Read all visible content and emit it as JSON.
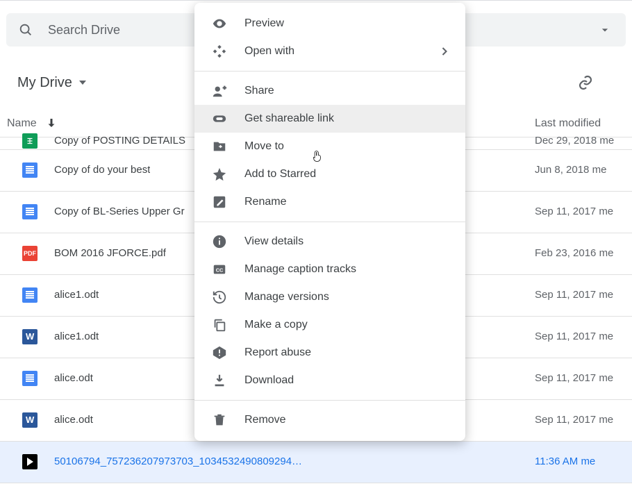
{
  "search": {
    "placeholder": "Search Drive"
  },
  "breadcrumb": {
    "label": "My Drive"
  },
  "columns": {
    "name": "Name",
    "modified": "Last modified"
  },
  "rows": [
    {
      "type": "sheets",
      "name": "Copy of POSTING DETAILS",
      "date": "Dec 29, 2018",
      "who": "me",
      "cut": true
    },
    {
      "type": "docs",
      "name": "Copy of do your best",
      "date": "Jun 8, 2018",
      "who": "me"
    },
    {
      "type": "docs",
      "name": "Copy of BL-Series Upper Gr",
      "date": "Sep 11, 2017",
      "who": "me"
    },
    {
      "type": "pdf",
      "name": "BOM 2016 JFORCE.pdf",
      "date": "Feb 23, 2016",
      "who": "me"
    },
    {
      "type": "docs",
      "name": "alice1.odt",
      "date": "Sep 11, 2017",
      "who": "me"
    },
    {
      "type": "word",
      "name": "alice1.odt",
      "date": "Sep 11, 2017",
      "who": "me"
    },
    {
      "type": "docs",
      "name": "alice.odt",
      "date": "Sep 11, 2017",
      "who": "me"
    },
    {
      "type": "word",
      "name": "alice.odt",
      "date": "Sep 11, 2017",
      "who": "me"
    },
    {
      "type": "video",
      "name": "50106794_757236207973703_1034532490809294…",
      "date": "11:36 AM",
      "who": "me",
      "selected": true
    }
  ],
  "menu": {
    "highlight_index": 3,
    "items": [
      {
        "icon": "eye",
        "label": "Preview"
      },
      {
        "icon": "openwith",
        "label": "Open with",
        "chevron": true
      },
      {
        "sep": true
      },
      {
        "icon": "share",
        "label": "Share"
      },
      {
        "icon": "link",
        "label": "Get shareable link"
      },
      {
        "icon": "moveto",
        "label": "Move to"
      },
      {
        "icon": "star",
        "label": "Add to Starred"
      },
      {
        "icon": "rename",
        "label": "Rename"
      },
      {
        "sep": true
      },
      {
        "icon": "info",
        "label": "View details"
      },
      {
        "icon": "cc",
        "label": "Manage caption tracks"
      },
      {
        "icon": "history",
        "label": "Manage versions"
      },
      {
        "icon": "copy",
        "label": "Make a copy"
      },
      {
        "icon": "report",
        "label": "Report abuse"
      },
      {
        "icon": "download",
        "label": "Download"
      },
      {
        "sep": true
      },
      {
        "icon": "trash",
        "label": "Remove"
      }
    ]
  }
}
